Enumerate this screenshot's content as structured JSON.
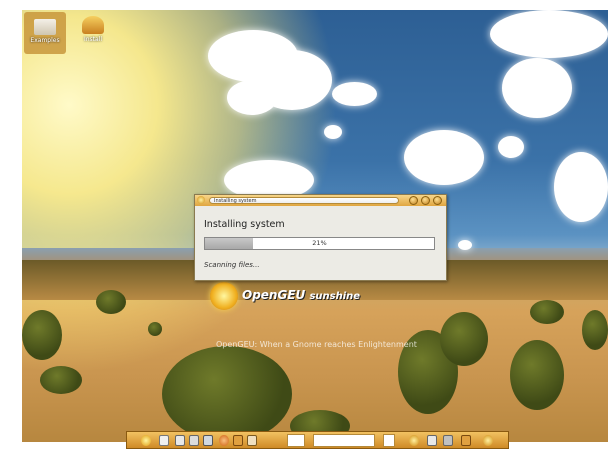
{
  "desktop": {
    "icons": [
      {
        "label": "Examples"
      },
      {
        "label": "Install"
      }
    ],
    "logo": {
      "brand": "OpenGEU",
      "edition": "sunshine"
    },
    "tagline": "OpenGEU: When a Gnome reaches Enlightenment"
  },
  "dialog": {
    "title": "Installing system",
    "heading": "Installing system",
    "progress": {
      "value": 0.21,
      "label": "21%"
    },
    "status": "Scanning files..."
  }
}
